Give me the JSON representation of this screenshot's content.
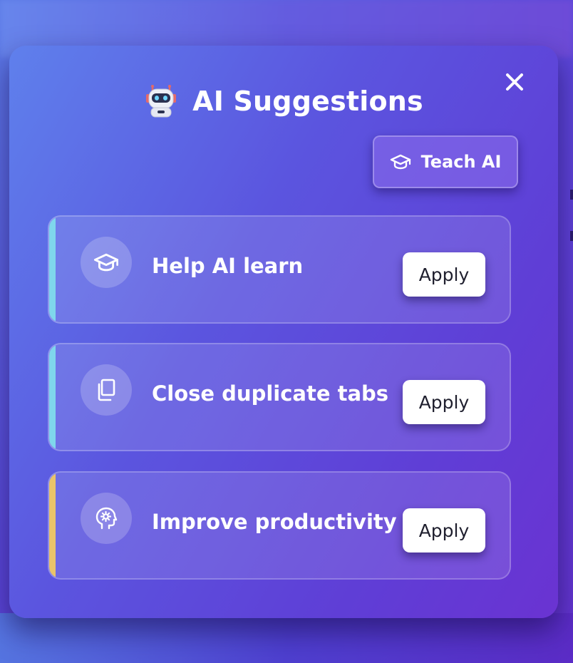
{
  "header": {
    "title": "AI Suggestions",
    "robot_icon": "robot-icon",
    "close_icon": "close-icon"
  },
  "teach_button": {
    "label": "Teach AI",
    "icon": "graduation-cap-icon"
  },
  "suggestions": [
    {
      "title": "Help AI learn",
      "icon": "graduation-cap-icon",
      "accent_color": "#7fd6ec",
      "action_label": "Apply"
    },
    {
      "title": "Close duplicate tabs",
      "icon": "copy-icon",
      "accent_color": "#7fd6ec",
      "action_label": "Apply"
    },
    {
      "title": "Improve productivity",
      "icon": "brain-gear-icon",
      "accent_color": "#e9c46a",
      "action_label": "Apply"
    }
  ],
  "colors": {
    "background_start": "#5b7be6",
    "background_end": "#6433cf",
    "accent_cyan": "#7fd6ec",
    "accent_yellow": "#e9c46a",
    "button_bg": "#ffffff"
  }
}
